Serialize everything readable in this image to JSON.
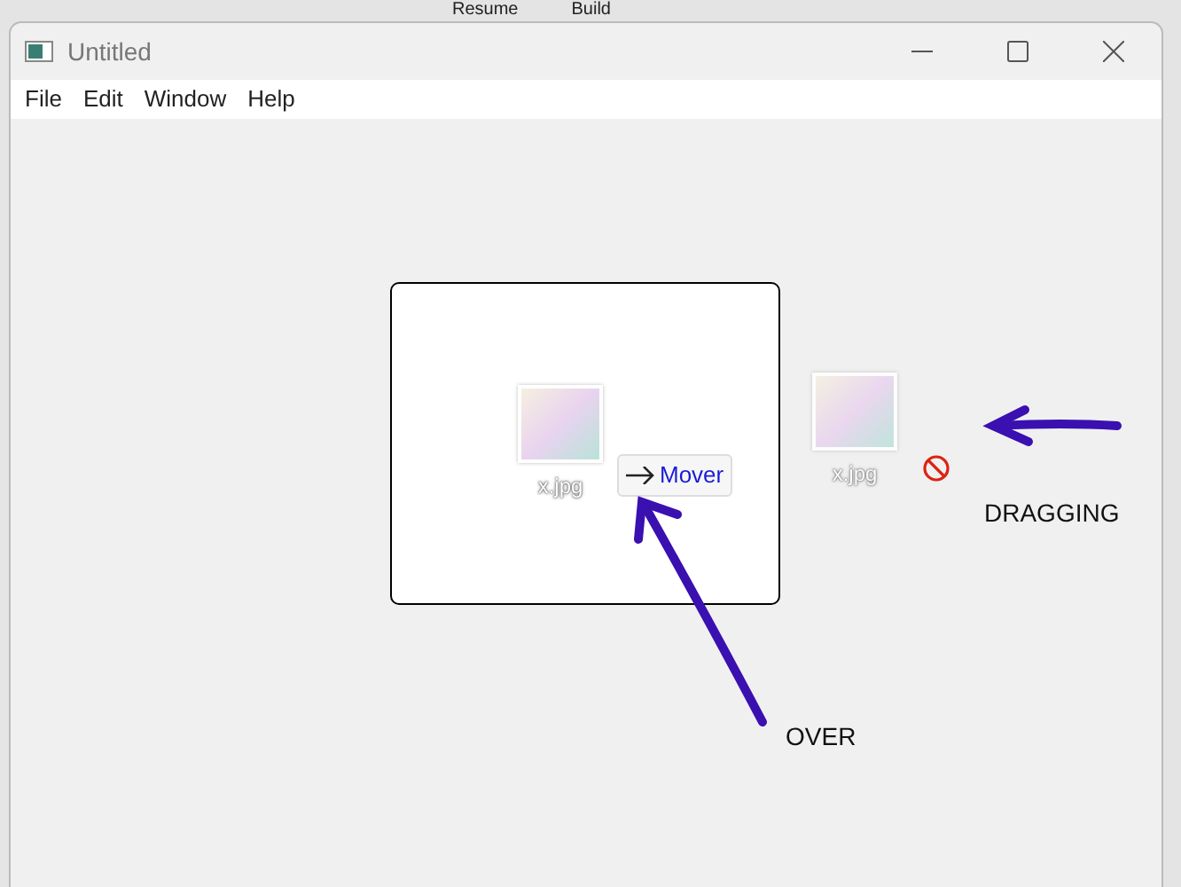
{
  "background_app": {
    "texts": [
      "Resume",
      "Build"
    ]
  },
  "window": {
    "title": "Untitled"
  },
  "menu": [
    {
      "label": "File"
    },
    {
      "label": "Edit"
    },
    {
      "label": "Window"
    },
    {
      "label": "Help"
    }
  ],
  "drop_target": {
    "item": {
      "label": "x.jpg"
    },
    "drop_hint": {
      "label": "Mover"
    }
  },
  "drag_item": {
    "label": "x.jpg",
    "drop_allowed": false
  },
  "annotations": [
    {
      "text": "DRAGGING",
      "kind": "left"
    },
    {
      "text": "OVER",
      "kind": "up"
    }
  ]
}
